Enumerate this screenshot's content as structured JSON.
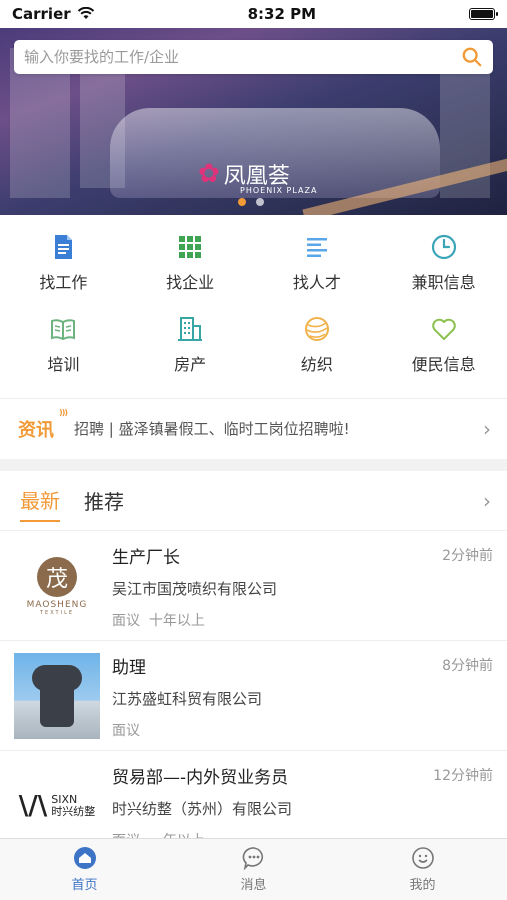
{
  "status_bar": {
    "carrier": "Carrier",
    "time": "8:32 PM"
  },
  "search": {
    "placeholder": "输入你要找的工作/企业",
    "icon": "search-icon"
  },
  "banner": {
    "logo_name": "凤凰荟",
    "logo_sub": "PHOENIX PLAZA",
    "page_count": 2,
    "active_page": 1
  },
  "grid": [
    {
      "label": "找工作",
      "icon": "document-icon",
      "color": "#3a7fd5"
    },
    {
      "label": "找企业",
      "icon": "grid-icon",
      "color": "#3fa553"
    },
    {
      "label": "找人才",
      "icon": "list-icon",
      "color": "#5ba6e8"
    },
    {
      "label": "兼职信息",
      "icon": "clock-icon",
      "color": "#3ba5b8"
    },
    {
      "label": "培训",
      "icon": "book-icon",
      "color": "#6cb37f"
    },
    {
      "label": "房产",
      "icon": "building-icon",
      "color": "#38a6a5"
    },
    {
      "label": "纺织",
      "icon": "yarn-icon",
      "color": "#f2b24a"
    },
    {
      "label": "便民信息",
      "icon": "heart-icon",
      "color": "#8cc152"
    }
  ],
  "news": {
    "tag": "资讯",
    "text": "招聘 | 盛泽镇暑假工、临时工岗位招聘啦!"
  },
  "tabs": {
    "latest": "最新",
    "recommended": "推荐"
  },
  "jobs": [
    {
      "title": "生产厂长",
      "time": "2分钟前",
      "company": "吴江市国茂喷织有限公司",
      "salary": "面议",
      "experience": "十年以上",
      "logo": {
        "type": "maosheng",
        "mark": "茂",
        "line1": "MAOSHENG",
        "line2": "TEXTILE"
      }
    },
    {
      "title": "助理",
      "time": "8分钟前",
      "company": "江苏盛虹科贸有限公司",
      "salary": "面议",
      "experience": "",
      "logo": {
        "type": "photo"
      }
    },
    {
      "title": "贸易部—-内外贸业务员",
      "time": "12分钟前",
      "company": "时兴纺整（苏州）有限公司",
      "salary": "面议",
      "experience": "一年以上",
      "logo": {
        "type": "sixn",
        "mark": "\\/\\",
        "line1": "SIXN",
        "line2": "时兴纺整"
      }
    }
  ],
  "tabbar": [
    {
      "label": "首页",
      "icon": "home-icon",
      "active": true
    },
    {
      "label": "消息",
      "icon": "message-icon",
      "active": false
    },
    {
      "label": "我的",
      "icon": "smiley-icon",
      "active": false
    }
  ],
  "colors": {
    "accent": "#f19a37",
    "tab_active": "#3d74c5"
  }
}
